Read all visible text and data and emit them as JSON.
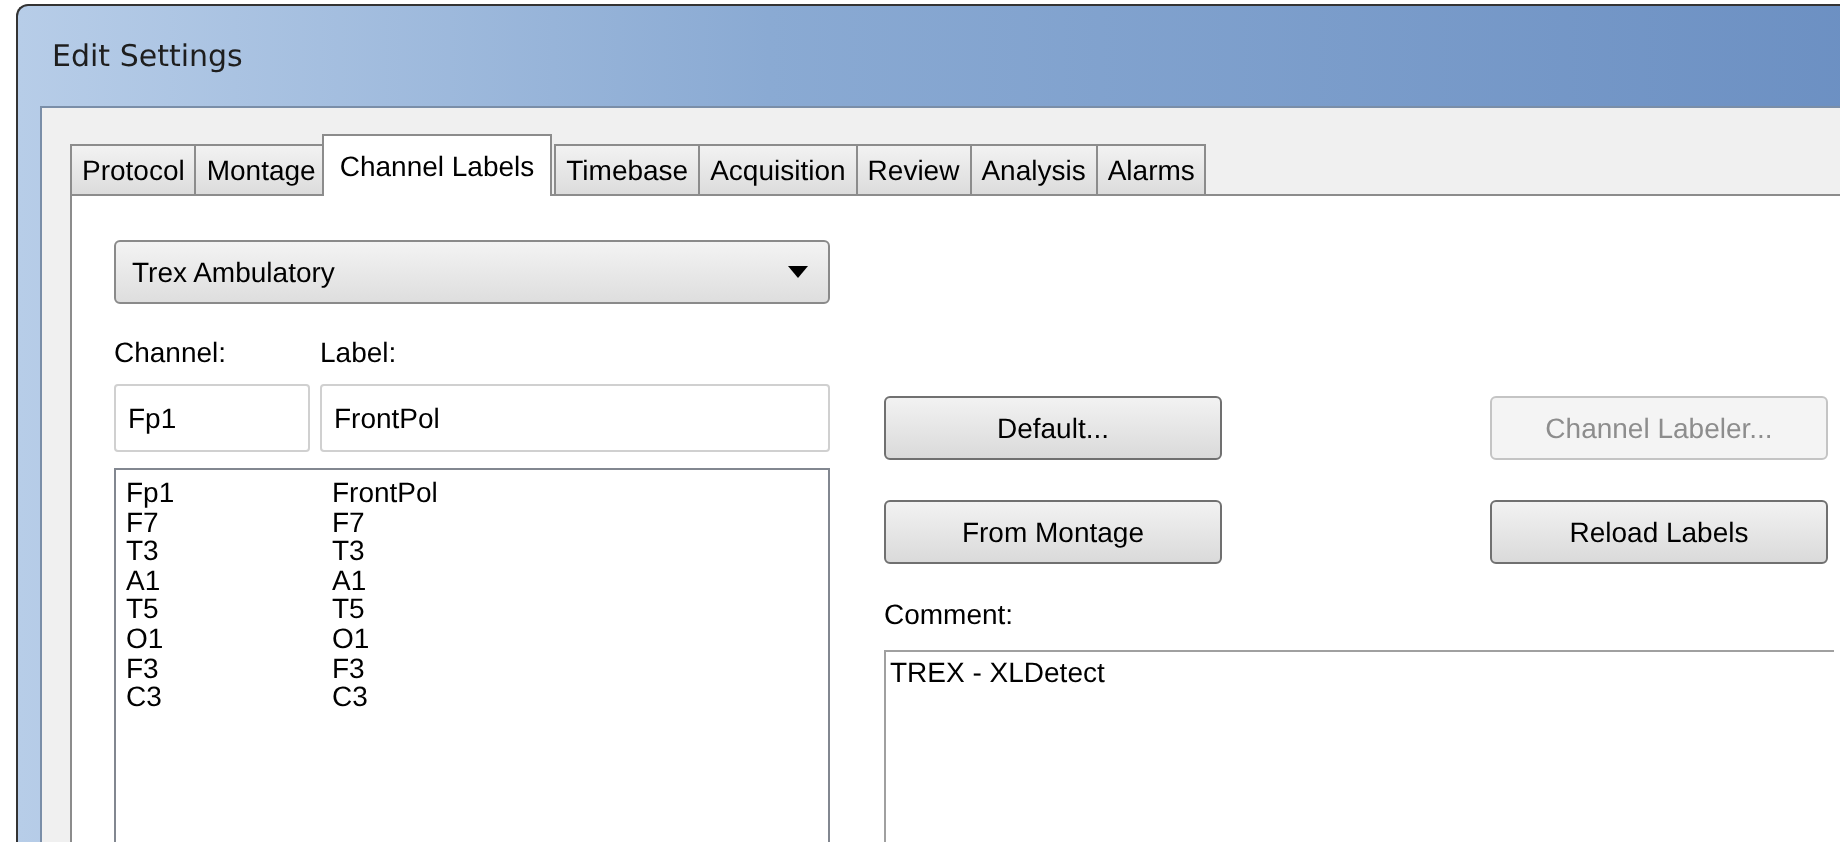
{
  "window": {
    "title": "Edit Settings"
  },
  "tabs": [
    {
      "label": "Protocol",
      "selected": false
    },
    {
      "label": "Montage",
      "selected": false
    },
    {
      "label": "Channel Labels",
      "selected": true
    },
    {
      "label": "Timebase",
      "selected": false
    },
    {
      "label": "Acquisition",
      "selected": false
    },
    {
      "label": "Review",
      "selected": false
    },
    {
      "label": "Analysis",
      "selected": false
    },
    {
      "label": "Alarms",
      "selected": false
    }
  ],
  "montage_dropdown": {
    "value": "Trex Ambulatory"
  },
  "channel_field": {
    "label": "Channel:",
    "value": "Fp1"
  },
  "label_field": {
    "label": "Label:",
    "value": "FrontPol"
  },
  "channel_list": [
    {
      "channel": "Fp1",
      "label": "FrontPol"
    },
    {
      "channel": "F7",
      "label": "F7"
    },
    {
      "channel": "T3",
      "label": "T3"
    },
    {
      "channel": "A1",
      "label": "A1"
    },
    {
      "channel": "T5",
      "label": "T5"
    },
    {
      "channel": "O1",
      "label": "O1"
    },
    {
      "channel": "F3",
      "label": "F3"
    },
    {
      "channel": "C3",
      "label": "C3"
    }
  ],
  "buttons": [
    {
      "label": "Default...",
      "disabled": false
    },
    {
      "label": "Channel Labeler...",
      "disabled": true
    },
    {
      "label": "From Montage",
      "disabled": false
    },
    {
      "label": "Reload Labels",
      "disabled": false
    }
  ],
  "comment": {
    "label": "Comment:",
    "value": "TREX - XLDetect"
  }
}
